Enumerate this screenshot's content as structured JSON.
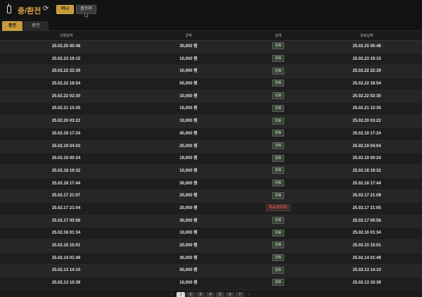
{
  "header": {
    "wallet_icon": "wallet-icon",
    "title": "충/환전",
    "refresh_icon": "refresh-icon",
    "money_button": "머니",
    "point_button": "콤프머니"
  },
  "tabs": [
    {
      "label": "충전",
      "active": true
    },
    {
      "label": "환전",
      "active": false
    }
  ],
  "table": {
    "columns": [
      "신청날짜",
      "금액",
      "상태",
      "완료날짜"
    ],
    "rows": [
      {
        "request_date": "25.02.25 00:48",
        "amount": "30,000 원",
        "status": "완료",
        "status_type": "done",
        "complete_date": "25.02.25 00:48"
      },
      {
        "request_date": "25.02.23 19:15",
        "amount": "10,000 원",
        "status": "완료",
        "status_type": "done",
        "complete_date": "25.02.23 19:15"
      },
      {
        "request_date": "25.02.22 22:39",
        "amount": "10,000 원",
        "status": "완료",
        "status_type": "done",
        "complete_date": "25.02.22 22:39"
      },
      {
        "request_date": "25.02.22 18:54",
        "amount": "50,000 원",
        "status": "완료",
        "status_type": "done",
        "complete_date": "25.02.22 18:54"
      },
      {
        "request_date": "25.02.22 02:30",
        "amount": "10,000 원",
        "status": "완료",
        "status_type": "done",
        "complete_date": "25.02.22 02:30"
      },
      {
        "request_date": "25.02.21 13:35",
        "amount": "15,000 원",
        "status": "완료",
        "status_type": "done",
        "complete_date": "25.02.21 13:35"
      },
      {
        "request_date": "25.02.20 03:22",
        "amount": "10,000 원",
        "status": "완료",
        "status_type": "done",
        "complete_date": "25.02.20 03:22"
      },
      {
        "request_date": "25.02.19 17:24",
        "amount": "40,000 원",
        "status": "완료",
        "status_type": "done",
        "complete_date": "25.02.19 17:24"
      },
      {
        "request_date": "25.02.19 04:03",
        "amount": "20,000 원",
        "status": "완료",
        "status_type": "done",
        "complete_date": "25.02.19 04:04"
      },
      {
        "request_date": "25.02.19 00:24",
        "amount": "19,000 원",
        "status": "완료",
        "status_type": "done",
        "complete_date": "25.02.19 00:24"
      },
      {
        "request_date": "25.02.18 19:32",
        "amount": "10,000 원",
        "status": "완료",
        "status_type": "done",
        "complete_date": "25.02.18 19:32"
      },
      {
        "request_date": "25.02.18 17:44",
        "amount": "30,000 원",
        "status": "완료",
        "status_type": "done",
        "complete_date": "25.02.18 17:44"
      },
      {
        "request_date": "25.02.17 21:07",
        "amount": "20,000 원",
        "status": "완료",
        "status_type": "done",
        "complete_date": "25.02.17 21:08"
      },
      {
        "request_date": "25.02.17 21:04",
        "amount": "20,000 원",
        "status": "취소(관리자)",
        "status_type": "cancel",
        "complete_date": "25.02.17 21:05"
      },
      {
        "request_date": "25.02.17 00:56",
        "amount": "30,000 원",
        "status": "완료",
        "status_type": "done",
        "complete_date": "25.02.17 00:56"
      },
      {
        "request_date": "25.02.16 01:34",
        "amount": "10,000 원",
        "status": "완료",
        "status_type": "done",
        "complete_date": "25.02.16 01:34"
      },
      {
        "request_date": "25.02.15 15:01",
        "amount": "20,000 원",
        "status": "완료",
        "status_type": "done",
        "complete_date": "25.02.15 15:01"
      },
      {
        "request_date": "25.02.14 01:49",
        "amount": "30,000 원",
        "status": "완료",
        "status_type": "done",
        "complete_date": "25.02.14 01:49"
      },
      {
        "request_date": "25.02.13 14:10",
        "amount": "50,000 원",
        "status": "완료",
        "status_type": "done",
        "complete_date": "25.02.13 14:10"
      },
      {
        "request_date": "25.02.13 10:39",
        "amount": "10,000 원",
        "status": "완료",
        "status_type": "done",
        "complete_date": "25.02.13 10:39"
      }
    ]
  },
  "pagination": {
    "prev": "‹",
    "next": "›",
    "pages": [
      "1",
      "2",
      "3",
      "4",
      "5",
      "6",
      "7"
    ],
    "current": "1"
  }
}
